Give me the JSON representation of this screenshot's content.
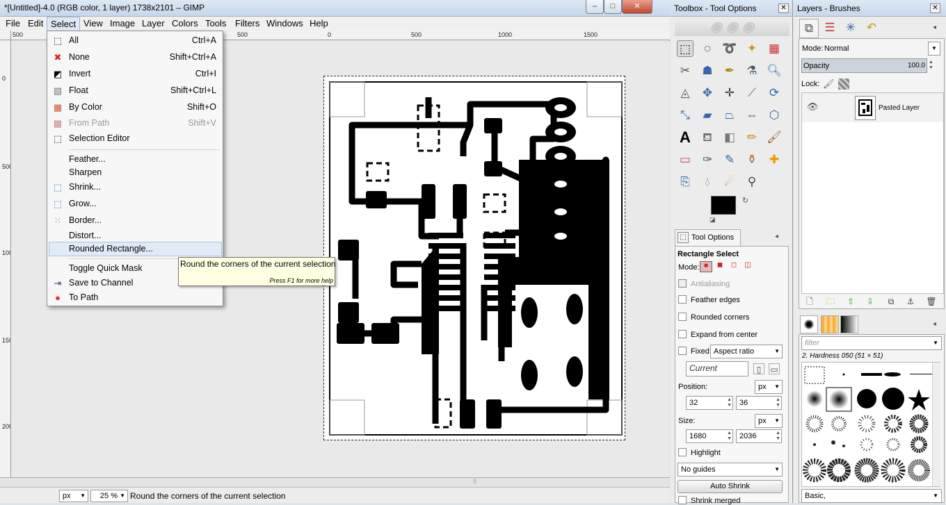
{
  "window": {
    "title": "*[Untitled]-4.0 (RGB color, 1 layer) 1738x2101 – GIMP"
  },
  "menubar": [
    "File",
    "Edit",
    "Select",
    "View",
    "Image",
    "Layer",
    "Colors",
    "Tools",
    "Filters",
    "Windows",
    "Help"
  ],
  "ruler": {
    "h_labels": [
      "500",
      "0",
      "500",
      "1000",
      "1500"
    ],
    "v_labels": [
      "0",
      "500",
      "1000",
      "1500",
      "2000"
    ]
  },
  "select_menu": {
    "items": [
      {
        "label": "All",
        "shortcut": "Ctrl+A",
        "icon": "select-all-icon",
        "glyph": "⬚"
      },
      {
        "label": "None",
        "shortcut": "Shift+Ctrl+A",
        "icon": "select-none-icon",
        "glyph": "✖"
      },
      {
        "label": "Invert",
        "shortcut": "Ctrl+I",
        "icon": "invert-icon",
        "glyph": "◩"
      },
      {
        "label": "Float",
        "shortcut": "Shift+Ctrl+L",
        "icon": "float-icon",
        "glyph": "▧"
      },
      {
        "label": "By Color",
        "shortcut": "Shift+O",
        "icon": "by-color-icon",
        "glyph": "▦"
      },
      {
        "label": "From Path",
        "shortcut": "Shift+V",
        "icon": "from-path-icon",
        "glyph": "▩"
      },
      {
        "label": "Selection Editor",
        "shortcut": "",
        "icon": "selection-editor-icon",
        "glyph": "⬚"
      },
      {
        "label": "Feather...",
        "shortcut": "",
        "icon": "",
        "glyph": ""
      },
      {
        "label": "Sharpen",
        "shortcut": "",
        "icon": "",
        "glyph": ""
      },
      {
        "label": "Shrink...",
        "shortcut": "",
        "icon": "shrink-icon",
        "glyph": "⬚"
      },
      {
        "label": "Grow...",
        "shortcut": "",
        "icon": "grow-icon",
        "glyph": "⬚"
      },
      {
        "label": "Border...",
        "shortcut": "",
        "icon": "border-icon",
        "glyph": "⁙"
      },
      {
        "label": "Distort...",
        "shortcut": "",
        "icon": "",
        "glyph": ""
      },
      {
        "label": "Rounded Rectangle...",
        "shortcut": "",
        "icon": "",
        "glyph": ""
      },
      {
        "label": "Toggle Quick Mask",
        "shortcut": "",
        "icon": "",
        "glyph": ""
      },
      {
        "label": "Save to Channel",
        "shortcut": "",
        "icon": "save-channel-icon",
        "glyph": "⇥"
      },
      {
        "label": "To Path",
        "shortcut": "",
        "icon": "to-path-icon",
        "glyph": "●"
      }
    ]
  },
  "tooltip": {
    "text": "Round the corners of the current selection",
    "hint": "Press F1 for more help"
  },
  "statusbar": {
    "unit": "px",
    "zoom": "25 %",
    "message": "Round the corners of the current selection"
  },
  "toolbox": {
    "title": "Toolbox - Tool Options",
    "tab_label": "Tool Options",
    "tool_name": "Rectangle Select",
    "mode_label": "Mode:",
    "antialiasing": "Antialiasing",
    "feather_edges": "Feather edges",
    "rounded_corners": "Rounded corners",
    "expand_from_center": "Expand from center",
    "fixed_label": "Fixed:",
    "fixed_value": "Aspect ratio",
    "current_value": "Current",
    "position_label": "Position:",
    "position_unit": "px",
    "pos_x": "32",
    "pos_y": "36",
    "size_label": "Size:",
    "size_unit": "px",
    "size_w": "1680",
    "size_h": "2036",
    "highlight": "Highlight",
    "guides": "No guides",
    "auto_shrink": "Auto Shrink",
    "shrink_merged": "Shrink merged",
    "fg_color": "#000000",
    "bg_color": "#ffffff"
  },
  "layers": {
    "title": "Layers - Brushes",
    "mode_label": "Mode:",
    "mode_value": "Normal",
    "opacity_label": "Opacity",
    "opacity_value": "100.0",
    "lock_label": "Lock:",
    "layer_name": "Pasted Layer",
    "brush_filter_placeholder": "filter",
    "brush_name": "2. Hardness 050 (51 × 51)",
    "brush_preset": "Basic,"
  }
}
